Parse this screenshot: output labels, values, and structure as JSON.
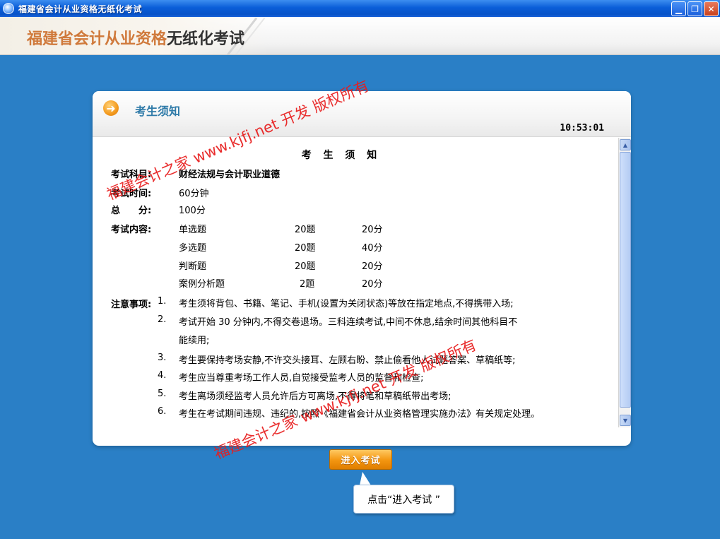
{
  "window": {
    "title": "福建省会计从业资格无纸化考试",
    "minimize_glyph": "▁",
    "restore_glyph": "❐",
    "close_glyph": "✕"
  },
  "header": {
    "title_part1": "福建省会计从业资格",
    "title_part2": "无纸化考试"
  },
  "panel": {
    "title": "考生须知",
    "clock": "10:53:01",
    "arrow_glyph": "➜"
  },
  "notice": {
    "heading": "考 生 须 知",
    "subject_label": "考试科目:",
    "subject_value": "财经法规与会计职业道德",
    "time_label": "考试时间:",
    "time_value": "60分钟",
    "score_label": "总　　分:",
    "score_value": "100分",
    "content_label": "考试内容:",
    "content_rows": [
      {
        "type": "单选题",
        "count": "20题",
        "score": "20分"
      },
      {
        "type": "多选题",
        "count": "20题",
        "score": "40分"
      },
      {
        "type": "判断题",
        "count": "20题",
        "score": "20分"
      },
      {
        "type": "案例分析题",
        "count": "2题",
        "score": "20分"
      }
    ],
    "notes_label": "注意事项:",
    "notes": [
      {
        "num": "1.",
        "text": "考生须将背包、书籍、笔记、手机(设置为关闭状态)等放在指定地点,不得携带入场;"
      },
      {
        "num": "2.",
        "text": "考试开始 30 分钟内,不得交卷退场。三科连续考试,中间不休息,结余时间其他科目不"
      },
      {
        "num": "",
        "text": "能续用;"
      },
      {
        "num": "3.",
        "text": "考生要保持考场安静,不许交头接耳、左顾右盼、禁止偷看他人试题答案、草稿纸等;"
      },
      {
        "num": "4.",
        "text": "考生应当尊重考场工作人员,自觉接受监考人员的监督和检查;"
      },
      {
        "num": "5.",
        "text": "考生离场须经监考人员允许后方可离场,不得将笔和草稿纸带出考场;"
      },
      {
        "num": "6.",
        "text": "考生在考试期间违规、违纪的,按照《福建省会计从业资格管理实施办法》有关规定处理。"
      }
    ]
  },
  "enter_button": {
    "label": "进入考试"
  },
  "callout": {
    "text": "点击“进入考试 ”"
  },
  "watermark": {
    "text": "福建会计之家 www.kjfj.net 开发 版权所有"
  },
  "colors": {
    "desktop_bg": "#2a7fc6",
    "accent_orange": "#f3950f",
    "title_blue": "#2e7aa8",
    "watermark_red": "#e81c1c"
  }
}
